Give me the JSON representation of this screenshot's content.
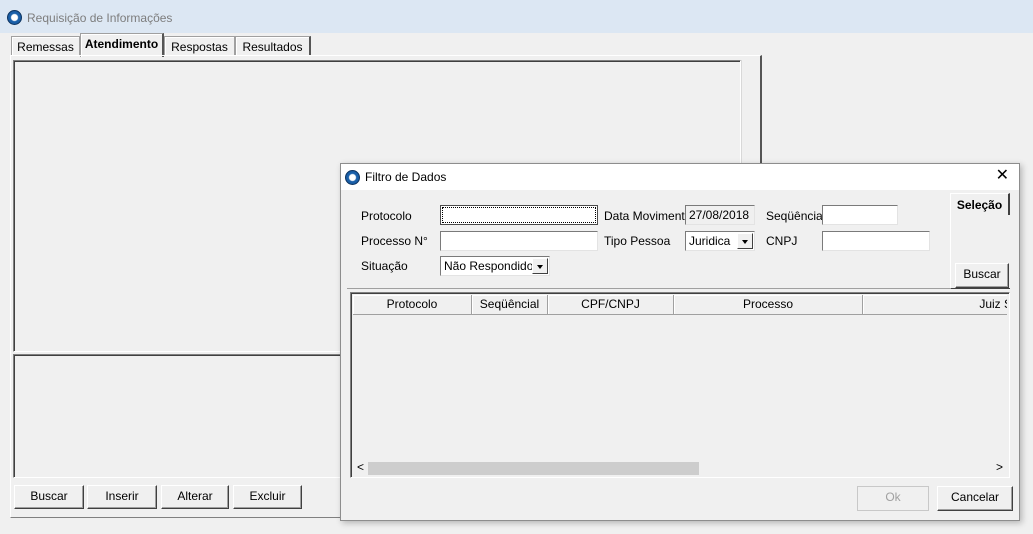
{
  "main_window": {
    "title": "Requisição de Informações",
    "tabs": [
      {
        "label": "Remessas"
      },
      {
        "label": "Atendimento"
      },
      {
        "label": "Respostas"
      },
      {
        "label": "Resultados"
      }
    ],
    "buttons": {
      "buscar": "Buscar",
      "inserir": "Inserir",
      "alterar": "Alterar",
      "excluir": "Excluir"
    }
  },
  "dialog": {
    "title": "Filtro de Dados",
    "close_glyph": "✕",
    "fields": {
      "protocolo": {
        "label": "Protocolo",
        "value": ""
      },
      "processo": {
        "label": "Processo N°",
        "value": ""
      },
      "situacao": {
        "label": "Situação",
        "value": "Não Respondido"
      },
      "data_movimento": {
        "label": "Data Movimento",
        "value": "27/08/2018"
      },
      "tipo_pessoa": {
        "label": "Tipo Pessoa",
        "value": "Juridica"
      },
      "sequencial": {
        "label": "Seqüêncial",
        "value": ""
      },
      "cnpj": {
        "label": "CNPJ",
        "value": ""
      }
    },
    "selecao_tab": "Seleção",
    "buscar_button": "Buscar",
    "grid_columns": [
      "Protocolo",
      "Seqüêncial",
      "CPF/CNPJ",
      "Processo",
      "Juiz S"
    ],
    "scroll_left_glyph": "<",
    "scroll_right_glyph": ">",
    "ok_button": "Ok",
    "cancel_button": "Cancelar"
  }
}
